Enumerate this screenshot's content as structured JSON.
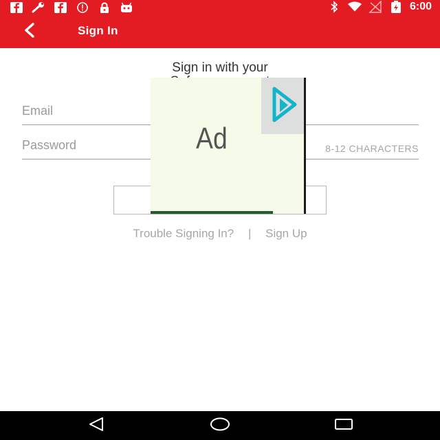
{
  "status_bar": {
    "time": "6:00",
    "left_icons": [
      "facebook-icon",
      "wrench-icon",
      "facebook-icon",
      "alert-icon",
      "lock-icon",
      "android-icon"
    ],
    "right_icons": [
      "bluetooth-icon",
      "wifi-icon",
      "no-signal-icon",
      "battery-charging-icon"
    ]
  },
  "app_bar": {
    "title": "Sign In",
    "back_icon": "chevron-left-icon",
    "color": "#e31b23"
  },
  "form": {
    "heading_line1": "Sign in with your",
    "heading_line2": "Safeway account",
    "email_placeholder": "Email",
    "password_placeholder": "Password",
    "password_hint": "8-12 CHARACTERS",
    "signin_label": "",
    "trouble_link": "Trouble Signing In?",
    "separator": "|",
    "signup_link": "Sign Up"
  },
  "ad": {
    "label": "Ad",
    "logo_icon": "play-icon"
  },
  "nav_bar": {
    "back_icon": "nav-back-icon",
    "home_icon": "nav-home-icon",
    "recent_icon": "nav-recents-icon"
  }
}
